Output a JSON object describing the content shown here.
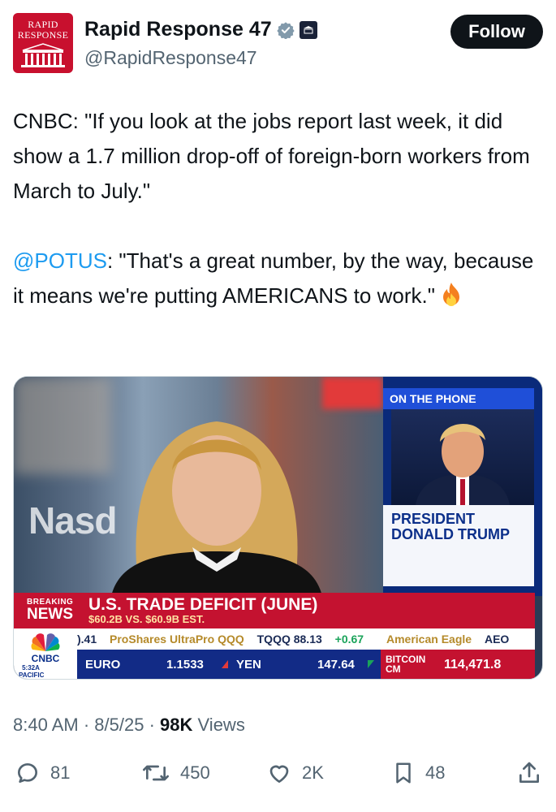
{
  "author": {
    "avatar_text": "RAPID RESPONSE",
    "display_name": "Rapid Response 47",
    "handle": "@RapidResponse47",
    "verified_color": "#829aab",
    "follow_label": "Follow"
  },
  "tweet": {
    "line1": "CNBC: \"If you look at the jobs report last week, it did show a 1.7 million drop-off of foreign-born workers from March to July.\"",
    "mention": "@POTUS",
    "line2": ": \"That's a great number, by the way, because it means we're putting AMERICANS to work.\"",
    "emoji": "fire"
  },
  "media": {
    "phone_header": "ON THE PHONE",
    "phone_name_1": "PRESIDENT",
    "phone_name_2": "DONALD TRUMP",
    "studio_sign": "Nasd",
    "breaking_1": "BREAKING",
    "breaking_2": "NEWS",
    "headline": "U.S. TRADE DEFICIT (JUNE)",
    "subhead": "$60.2B VS. $60.9B EST.",
    "ticker_top": [
      {
        "text": ").41",
        "dir": "up"
      },
      {
        "text": "ProShares UltraPro QQQ",
        "dir": ""
      },
      {
        "text": "TQQQ 88.13",
        "dir": ""
      },
      {
        "text": "+0.67",
        "dir": "up"
      },
      {
        "text": "American Eagle",
        "dir": ""
      },
      {
        "text": "AEO",
        "dir": ""
      }
    ],
    "network": "CNBC",
    "time": "5:32A PACIFIC",
    "euro_label": "EURO",
    "euro_value": "1.1533",
    "yen_label": "YEN",
    "yen_value": "147.64",
    "bitcoin_label_1": "BITCOIN",
    "bitcoin_label_2": "CM",
    "bitcoin_value": "114,471.8"
  },
  "meta": {
    "time": "8:40 AM",
    "date": "8/5/25",
    "views_count": "98K",
    "views_label": "Views"
  },
  "actions": {
    "replies": "81",
    "reposts": "450",
    "likes": "2K",
    "bookmarks": "48"
  }
}
